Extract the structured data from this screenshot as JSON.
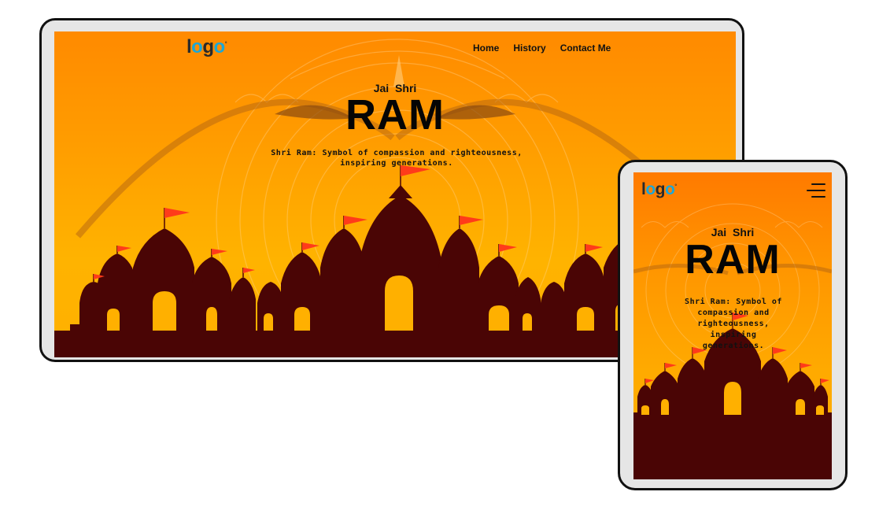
{
  "brand": {
    "logo_text_prefix": "l",
    "logo_text_o1": "o",
    "logo_text_g": "g",
    "logo_text_o2": "o",
    "logo_mark": "°"
  },
  "nav": {
    "items": [
      {
        "label": "Home"
      },
      {
        "label": "History"
      },
      {
        "label": "Contact Me"
      }
    ]
  },
  "hero": {
    "pre_title": "Jai Shri",
    "title": "RAM",
    "tagline": "Shri Ram: Symbol of compassion and righteousness, inspiring generations."
  },
  "icons": {
    "menu": "hamburger-menu-icon"
  },
  "colors": {
    "sky_top": "#ff8a00",
    "sky_bottom": "#ffb000",
    "temple": "#4a0505",
    "door": "#ffb000",
    "flag": "#ff3b1a",
    "logo_o": "#19a7d9"
  }
}
